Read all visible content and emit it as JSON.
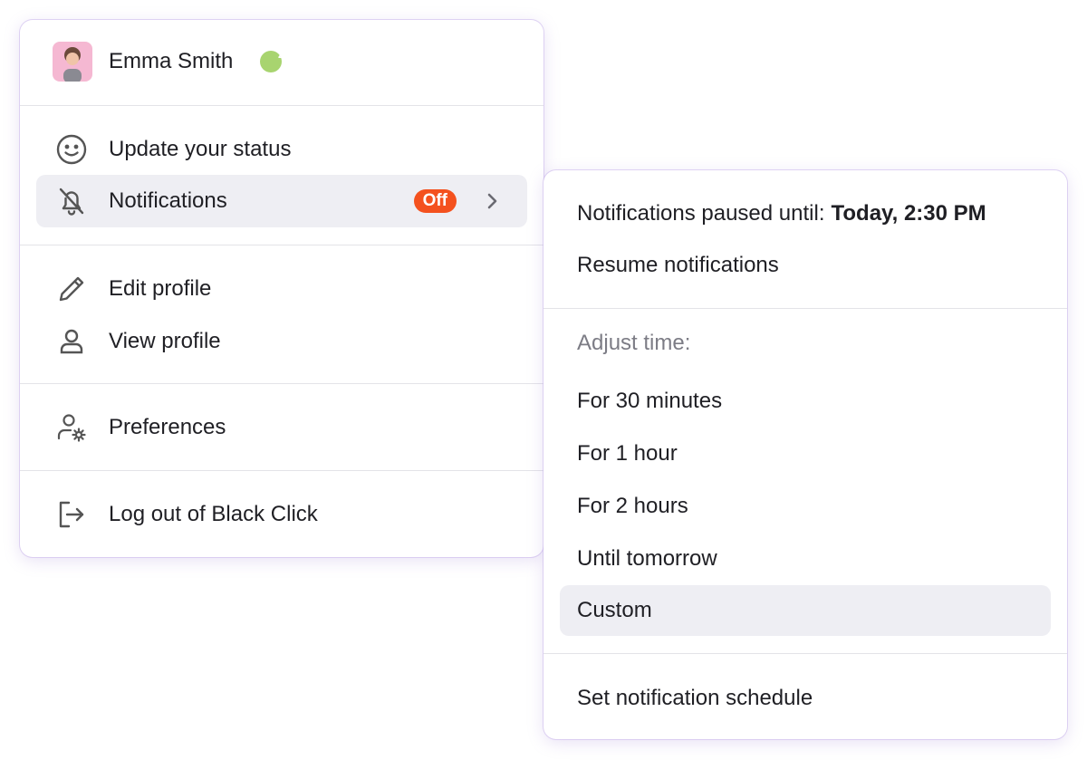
{
  "profile": {
    "name": "Emma Smith",
    "status_icon": "sleep-z-icon",
    "status_glyph": "z"
  },
  "main_menu": {
    "update_status": "Update your status",
    "notifications": "Notifications",
    "notifications_badge": "Off",
    "edit_profile": "Edit profile",
    "view_profile": "View profile",
    "preferences": "Preferences",
    "logout": "Log out of Black Click"
  },
  "submenu": {
    "paused_label": "Notifications paused until:",
    "paused_until": "Today, 2:30 PM",
    "resume": "Resume notifications",
    "adjust_heading": "Adjust time:",
    "options": [
      "For 30 minutes",
      "For 1 hour",
      "For 2 hours",
      "Until tomorrow",
      "Custom"
    ],
    "schedule": "Set notification schedule"
  },
  "colors": {
    "badge": "#f4511e",
    "highlight": "#eeeef3",
    "status_dot": "#a8d46f",
    "avatar_bg": "#f5b8d2"
  }
}
